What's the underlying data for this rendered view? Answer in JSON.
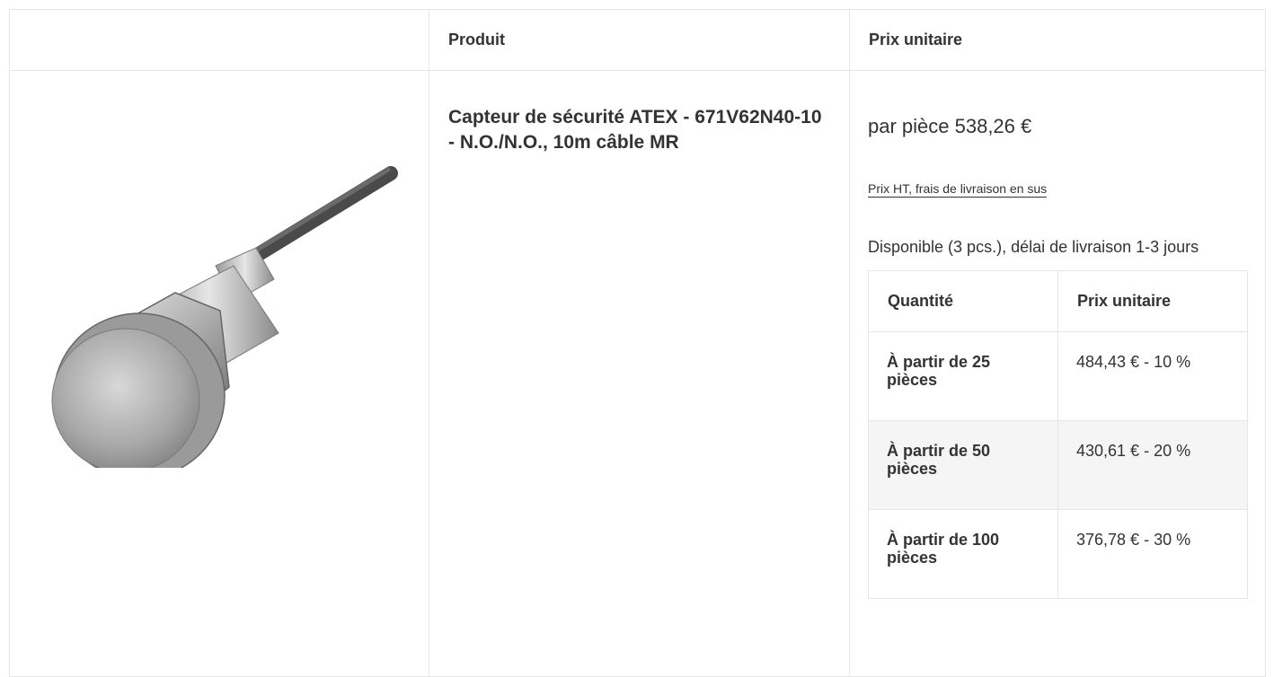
{
  "header": {
    "col_image": "",
    "col_product": "Produit",
    "col_price": "Prix unitaire"
  },
  "product": {
    "name": "Capteur de sécurité ATEX - 671V62N40-10 - N.O./N.O., 10m câble MR",
    "image_icon": "sensor-product-image"
  },
  "pricing": {
    "main_price": "par pièce 538,26 €",
    "tax_note": "Prix HT, frais de livraison en sus",
    "availability": "Disponible (3 pcs.), délai de livraison 1-3 jours",
    "tiers_header": {
      "quantity": "Quantité",
      "unit_price": "Prix unitaire"
    },
    "tiers": [
      {
        "quantity": "À partir de 25 pièces",
        "price": "484,43 € - 10 %"
      },
      {
        "quantity": "À partir de 50 pièces",
        "price": "430,61 € - 20 %"
      },
      {
        "quantity": "À partir de 100 pièces",
        "price": "376,78 € - 30 %"
      }
    ]
  }
}
